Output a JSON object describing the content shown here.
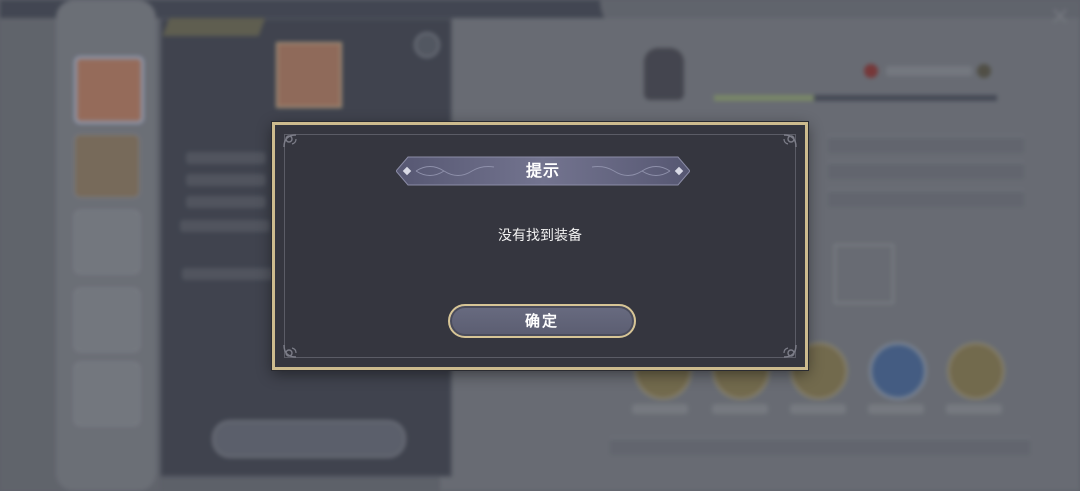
{
  "dialog": {
    "title": "提示",
    "message": "没有找到装备",
    "confirm_label": "确定"
  },
  "colors": {
    "frame_gold": "#cdbb8e",
    "panel_bg": "#35363f",
    "ribbon_purple": "#6e6f8e",
    "button_bg": "#636579"
  },
  "icons": {
    "corner_ornament": "corner-ornament-icon",
    "ribbon_diamond": "diamond-icon"
  }
}
